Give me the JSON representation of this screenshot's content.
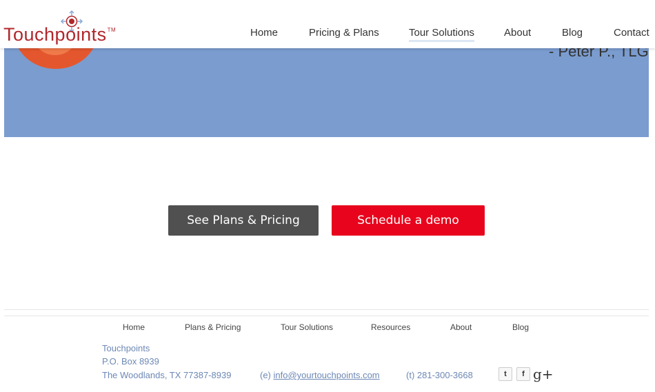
{
  "logo": {
    "text": "Touchpoints",
    "tm": "TM"
  },
  "nav": {
    "items": [
      {
        "label": "Home"
      },
      {
        "label": "Pricing & Plans"
      },
      {
        "label": "Tour Solutions"
      },
      {
        "label": "About"
      },
      {
        "label": "Blog"
      },
      {
        "label": "Contact"
      }
    ],
    "active": "Tour Solutions"
  },
  "hero": {
    "attribution": "- Peter P., TLG",
    "background": "#7b9ccf"
  },
  "cta": {
    "plans_label": "See Plans & Pricing",
    "demo_label": "Schedule a demo",
    "plans_color": "#505050",
    "demo_color": "#e8041c"
  },
  "footer": {
    "nav": [
      {
        "label": "Home"
      },
      {
        "label": "Plans & Pricing"
      },
      {
        "label": "Tour Solutions"
      },
      {
        "label": "Resources"
      },
      {
        "label": "About"
      },
      {
        "label": "Blog"
      }
    ],
    "company": "Touchpoints",
    "po_box": "P.O. Box 8939",
    "city": "The Woodlands, TX 77387-8939",
    "email_prefix": "(e)",
    "email": "info@yourtouchpoints.com",
    "phone": "(t) 281-300-3668",
    "social": {
      "twitter_glyph": "t",
      "facebook_glyph": "f",
      "gplus_glyph": "g+"
    }
  },
  "colors": {
    "brand_red": "#b0282c",
    "link_blue": "#6d88b5"
  }
}
